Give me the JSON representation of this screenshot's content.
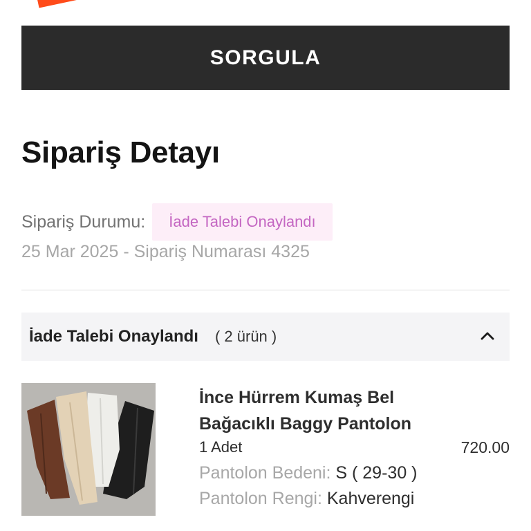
{
  "query": {
    "button_label": "SORGULA"
  },
  "page": {
    "title": "Sipariş Detayı"
  },
  "order": {
    "status_label": "Sipariş Durumu:",
    "status_badge": "İade Talebi Onaylandı",
    "meta_line": "25 Mar 2025 - Sipariş Numarası 4325"
  },
  "group": {
    "title": "İade Talebi Onaylandı",
    "count": "( 2 ürün )",
    "icon": "chevron-up-icon"
  },
  "product": {
    "name": "İnce Hürrem Kumaş Bel Bağacıklı Baggy Pantolon",
    "quantity": "1 Adet",
    "price": "720.00",
    "attributes": [
      {
        "label": "Pantolon Bedeni:",
        "value": "S ( 29-30 )"
      },
      {
        "label": "Pantolon Rengi:",
        "value": "Kahverengi"
      }
    ]
  },
  "colors": {
    "button_bg": "#2b2b2b",
    "badge_bg": "#fdeef8",
    "badge_text": "#c466c2",
    "brand_accent": "#ff4b1a"
  }
}
